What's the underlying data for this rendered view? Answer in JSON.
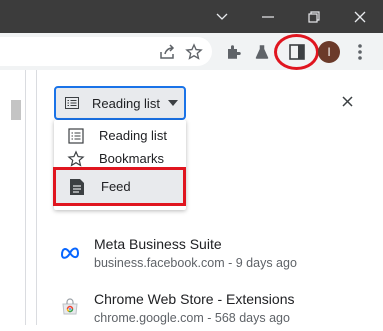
{
  "window_controls": {
    "chevron": "chevron-down-icon",
    "minimize": "minimize-icon",
    "restore": "restore-icon",
    "close": "close-icon"
  },
  "toolbar": {
    "profile_initial": "I",
    "icons": [
      "share-icon",
      "star-icon",
      "extensions-icon",
      "labs-icon",
      "side-panel-icon",
      "menu-icon"
    ]
  },
  "side_panel": {
    "selected": "Reading list",
    "dropdown": [
      {
        "label": "Reading list",
        "icon": "list-icon"
      },
      {
        "label": "Bookmarks",
        "icon": "star-outline-icon"
      },
      {
        "label": "Feed",
        "icon": "feed-icon"
      }
    ],
    "items": [
      {
        "title": "Meta Business Suite",
        "meta": "business.facebook.com - 9 days ago",
        "icon": "meta-logo-icon"
      },
      {
        "title": "Chrome Web Store - Extensions",
        "meta": "chrome.google.com - 568 days ago",
        "icon": "chrome-web-store-icon"
      }
    ]
  },
  "colors": {
    "highlight_red": "#e0151f",
    "accent_blue": "#1a73e8",
    "titlebar": "#3c3c3c"
  }
}
